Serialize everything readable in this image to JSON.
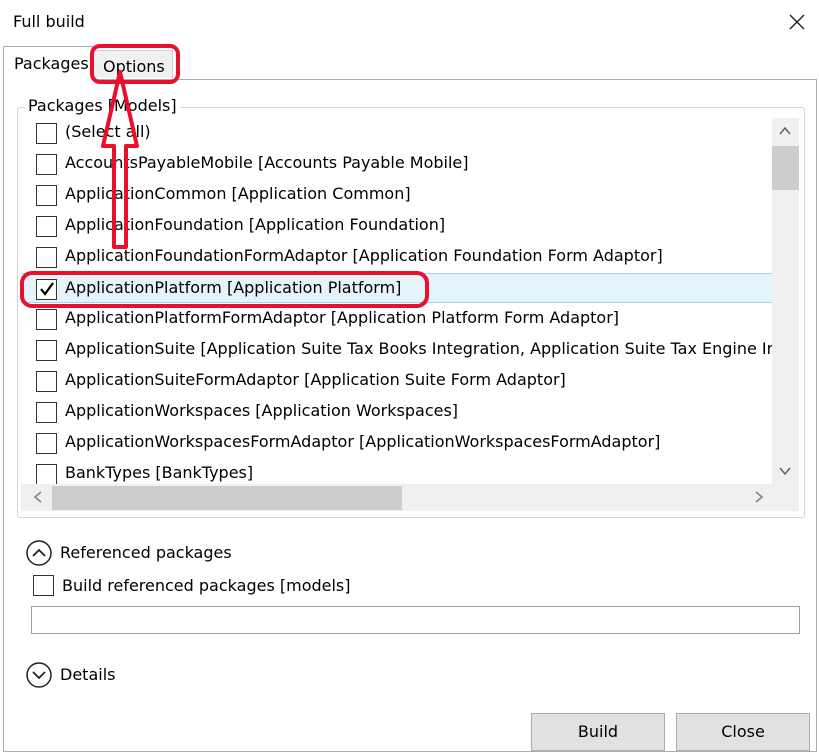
{
  "window": {
    "title": "Full build",
    "close_icon": "close-icon"
  },
  "tabs": [
    {
      "label": "Packages",
      "active": true
    },
    {
      "label": "Options",
      "active": false
    }
  ],
  "packages_group": {
    "legend": "Packages [Models]",
    "items": [
      {
        "label": "(Select all)",
        "checked": false
      },
      {
        "label": "AccountsPayableMobile [Accounts Payable Mobile]",
        "checked": false
      },
      {
        "label": "ApplicationCommon [Application Common]",
        "checked": false
      },
      {
        "label": "ApplicationFoundation [Application Foundation]",
        "checked": false
      },
      {
        "label": "ApplicationFoundationFormAdaptor [Application Foundation Form Adaptor]",
        "checked": false
      },
      {
        "label": "ApplicationPlatform [Application Platform]",
        "checked": true
      },
      {
        "label": "ApplicationPlatformFormAdaptor [Application Platform Form Adaptor]",
        "checked": false
      },
      {
        "label": "ApplicationSuite [Application Suite Tax Books Integration, Application Suite Tax Engine Integration]",
        "checked": false
      },
      {
        "label": "ApplicationSuiteFormAdaptor [Application Suite Form Adaptor]",
        "checked": false
      },
      {
        "label": "ApplicationWorkspaces [Application Workspaces]",
        "checked": false
      },
      {
        "label": "ApplicationWorkspacesFormAdaptor [ApplicationWorkspacesFormAdaptor]",
        "checked": false
      },
      {
        "label": "BankTypes [BankTypes]",
        "checked": false
      }
    ]
  },
  "referenced": {
    "header": "Referenced packages",
    "checkbox_label": "Build referenced packages [models]",
    "checked": false,
    "text_value": ""
  },
  "details": {
    "header": "Details"
  },
  "buttons": {
    "build": "Build",
    "close": "Close"
  },
  "annotation_color": "#e8112d"
}
